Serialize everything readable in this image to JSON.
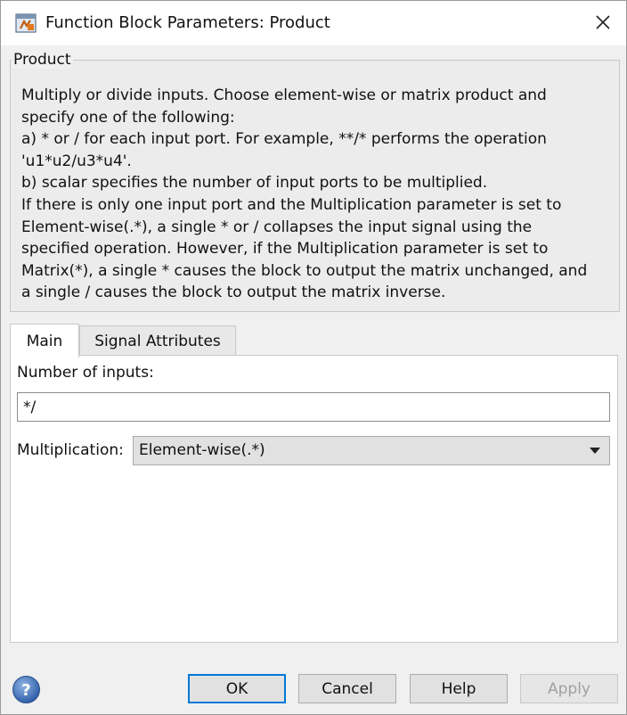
{
  "window": {
    "title": "Function Block Parameters: Product",
    "close_glyph": "✕"
  },
  "group": {
    "title": "Product",
    "description": [
      "Multiply or divide inputs.  Choose element-wise or matrix product and",
      "specify one of the following:",
      " a) * or / for each input port. For example, **/* performs the operation",
      "'u1*u2/u3*u4'.",
      " b) scalar specifies the number of input ports to be multiplied.",
      "If there is only one input port and the Multiplication parameter is set to",
      "Element-wise(.*), a single * or / collapses the input signal using the",
      "specified operation. However, if the Multiplication parameter is set to",
      "Matrix(*), a single * causes the block to output the matrix unchanged, and",
      "a single / causes the block to output the matrix inverse."
    ]
  },
  "tabs": [
    {
      "label": "Main",
      "active": true
    },
    {
      "label": "Signal Attributes",
      "active": false
    }
  ],
  "main": {
    "inputs_label": "Number of inputs:",
    "inputs_value": "*/",
    "multiplication_label": "Multiplication:",
    "multiplication_value": "Element-wise(.*)"
  },
  "buttons": {
    "ok": "OK",
    "cancel": "Cancel",
    "help": "Help",
    "apply": "Apply"
  },
  "icons": {
    "app": "simulink-block-icon",
    "help": "help-question-icon",
    "dropdown": "chevron-down-icon",
    "close": "close-icon"
  },
  "colors": {
    "focus_border": "#0078d7",
    "help_icon": "#3b6fb6"
  }
}
